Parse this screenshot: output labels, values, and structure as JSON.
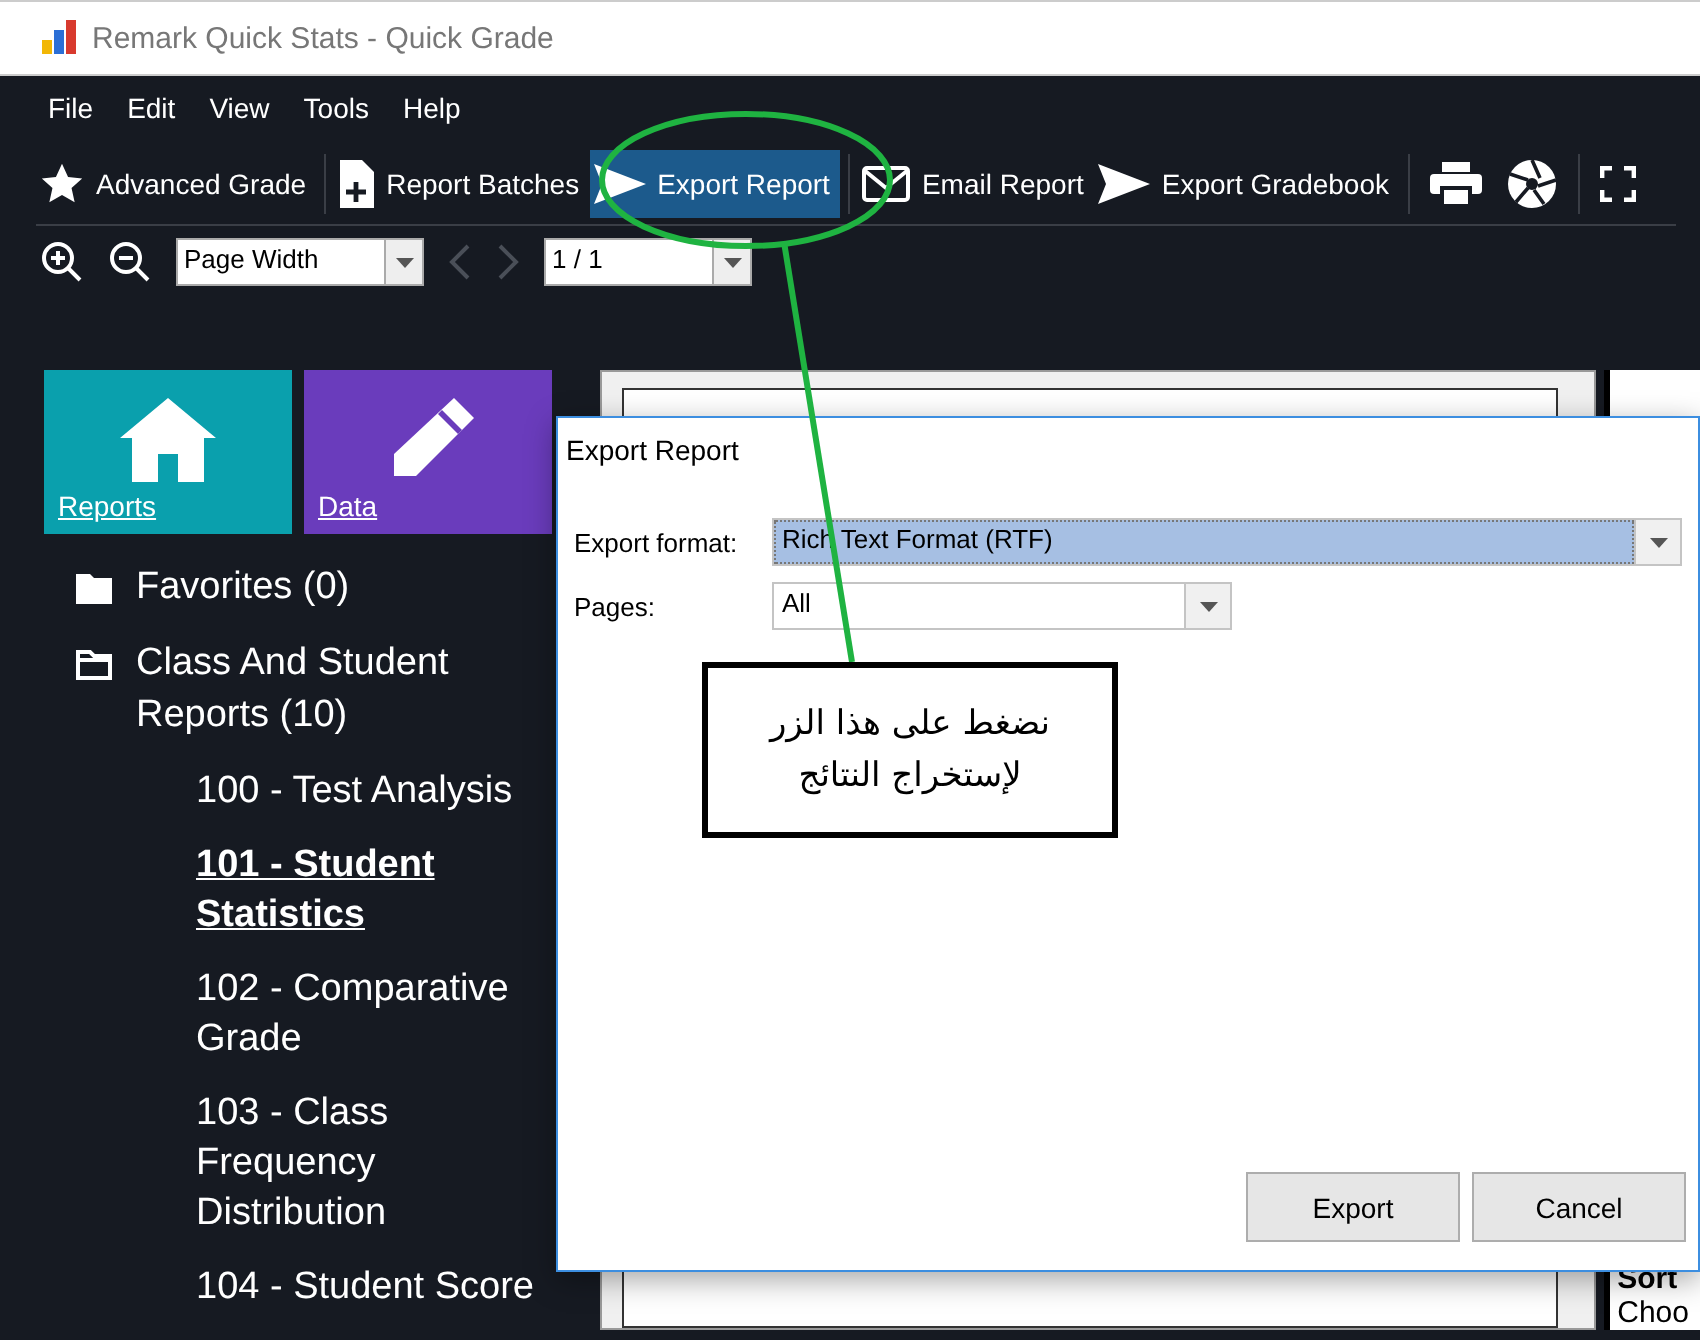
{
  "window": {
    "title": "Remark Quick Stats - Quick Grade"
  },
  "menu": [
    "File",
    "Edit",
    "View",
    "Tools",
    "Help"
  ],
  "toolbar": [
    {
      "label": "Advanced Grade",
      "kind": "star",
      "selected": false
    },
    {
      "label": "Report Batches",
      "kind": "file-plus",
      "selected": false
    },
    {
      "label": "Export Report",
      "kind": "send",
      "selected": true
    },
    {
      "label": "Email Report",
      "kind": "envelope",
      "selected": false
    },
    {
      "label": "Export Gradebook",
      "kind": "send",
      "selected": false
    }
  ],
  "zoom_bar": {
    "zoom": "Page Width",
    "page": "1 / 1",
    "nav_disabled": true
  },
  "tiles": [
    {
      "label": "Reports",
      "kind": "house",
      "color": "#0aa0ad"
    },
    {
      "label": "Data",
      "kind": "pencil",
      "color": "#6a3cbc"
    }
  ],
  "tree": [
    {
      "label": "Favorites (0)",
      "expanded": false,
      "selected": false
    },
    {
      "label": "Class And Student Reports (10)",
      "expanded": true,
      "selected": false,
      "children": [
        {
          "label": "100 - Test Analysis",
          "selected": false
        },
        {
          "label": "101 - Student Statistics",
          "selected": true
        },
        {
          "label": "102 - Comparative Grade",
          "selected": false
        },
        {
          "label": "103 - Class Frequency Distribution",
          "selected": false
        },
        {
          "label": "104 - Student Score",
          "selected": false
        }
      ]
    }
  ],
  "right_panel": [
    {
      "text": "Sort",
      "kind": "heading"
    },
    {
      "text": "Choo",
      "kind": "text"
    }
  ],
  "dialog": {
    "title": "Export Report",
    "fields": [
      {
        "label": "Export format:",
        "value": "Rich Text Format (RTF)",
        "focused": true
      },
      {
        "label": "Pages:",
        "value": "All",
        "focused": false
      }
    ],
    "buttons": [
      "Export",
      "Cancel"
    ]
  },
  "callout": {
    "lines": [
      "نضغط على هذا الزر",
      "لإستخراج النتائج"
    ]
  }
}
